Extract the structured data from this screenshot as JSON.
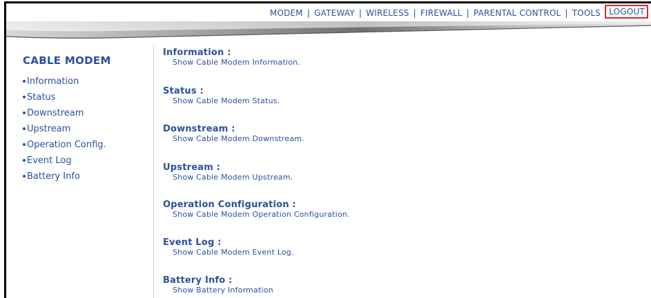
{
  "top_nav": {
    "items": [
      "MODEM",
      "GATEWAY",
      "WIRELESS",
      "FIREWALL",
      "PARENTAL CONTROL",
      "TOOLS"
    ],
    "separator": "|",
    "logout_label": "LOGOUT"
  },
  "sidebar": {
    "title": "CABLE MODEM",
    "items": [
      {
        "label": "Information"
      },
      {
        "label": "Status"
      },
      {
        "label": "Downstream"
      },
      {
        "label": "Upstream"
      },
      {
        "label": "Operation Config."
      },
      {
        "label": "Event Log"
      },
      {
        "label": "Battery Info"
      }
    ]
  },
  "main": {
    "sections": [
      {
        "title": "Information :",
        "description": "Show Cable Modem Information."
      },
      {
        "title": "Status :",
        "description": "Show Cable Modem Status."
      },
      {
        "title": "Downstream :",
        "description": "Show Cable Modem Downstream."
      },
      {
        "title": "Upstream :",
        "description": "Show Cable Modem Upstream."
      },
      {
        "title": "Operation Configuration :",
        "description": "Show Cable Modem Operation Configuration."
      },
      {
        "title": "Event Log :",
        "description": "Show Cable Modem Event Log."
      },
      {
        "title": "Battery Info :",
        "description": "Show Battery Information"
      }
    ]
  },
  "colors": {
    "link": "#2c4f9e",
    "highlight_border": "#d9262b"
  }
}
